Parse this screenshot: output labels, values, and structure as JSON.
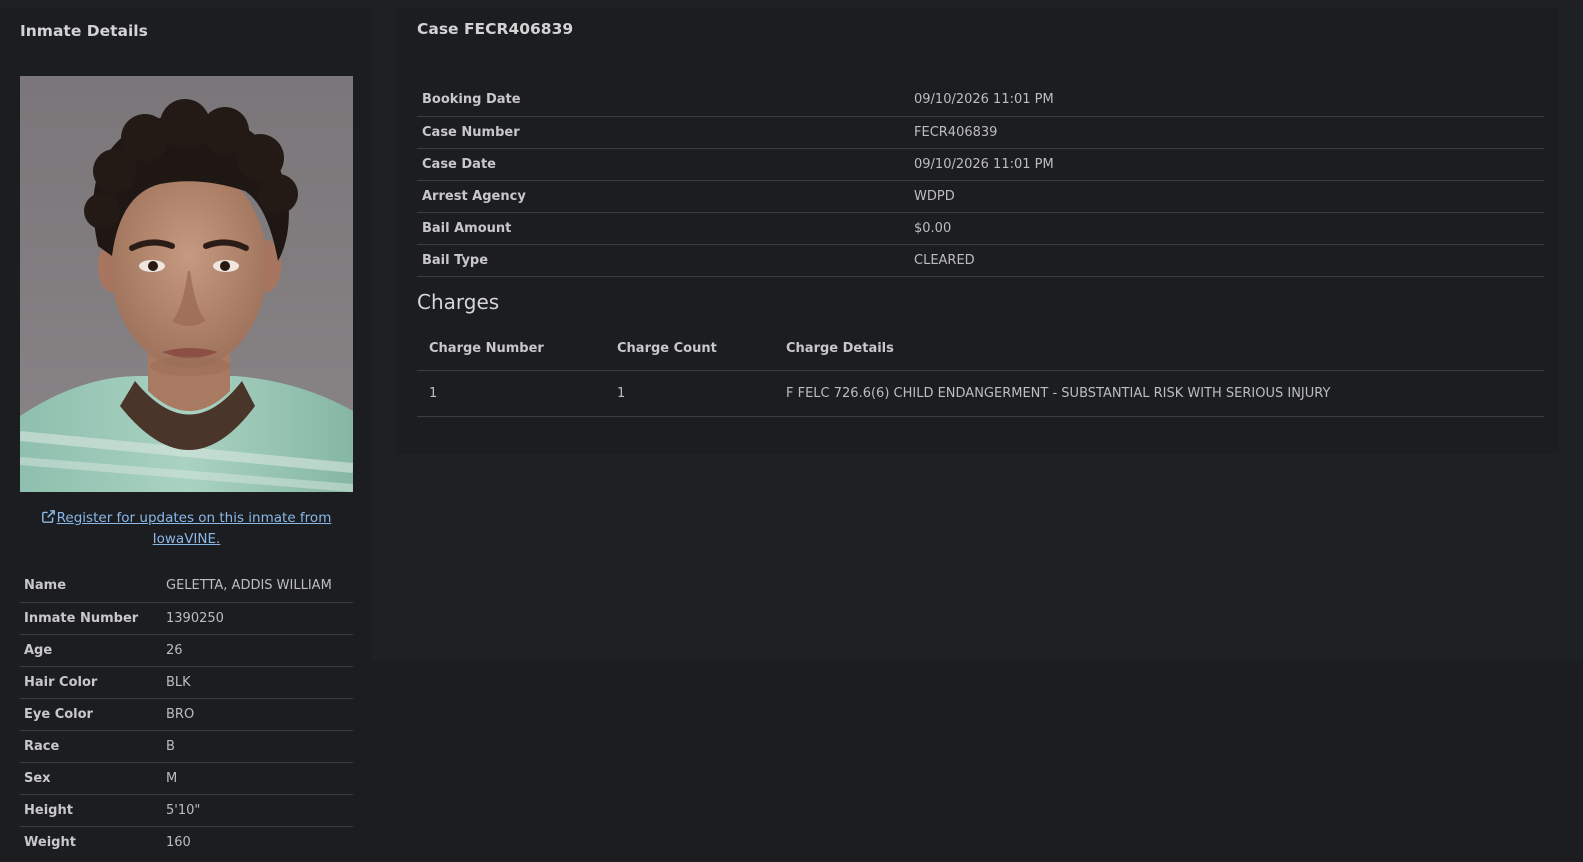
{
  "inmate": {
    "section_title": "Inmate Details",
    "register_link": "Register for updates on this inmate from IowaVINE.",
    "details": [
      {
        "label": "Name",
        "value": "GELETTA, ADDIS WILLIAM"
      },
      {
        "label": "Inmate Number",
        "value": "1390250"
      },
      {
        "label": "Age",
        "value": "26"
      },
      {
        "label": "Hair Color",
        "value": "BLK"
      },
      {
        "label": "Eye Color",
        "value": "BRO"
      },
      {
        "label": "Race",
        "value": "B"
      },
      {
        "label": "Sex",
        "value": "M"
      },
      {
        "label": "Height",
        "value": "5'10\""
      },
      {
        "label": "Weight",
        "value": "160"
      }
    ]
  },
  "case": {
    "title": "Case FECR406839",
    "details": [
      {
        "label": "Booking Date",
        "value": "09/10/2026 11:01 PM"
      },
      {
        "label": "Case Number",
        "value": "FECR406839"
      },
      {
        "label": "Case Date",
        "value": "09/10/2026 11:01 PM"
      },
      {
        "label": "Arrest Agency",
        "value": "WDPD"
      },
      {
        "label": "Bail Amount",
        "value": "$0.00"
      },
      {
        "label": "Bail Type",
        "value": "CLEARED"
      }
    ]
  },
  "charges": {
    "heading": "Charges",
    "columns": [
      "Charge Number",
      "Charge Count",
      "Charge Details"
    ],
    "rows": [
      {
        "number": "1",
        "count": "1",
        "details": "F FELC 726.6(6) CHILD ENDANGERMENT - SUBSTANTIAL RISK WITH SERIOUS INJURY"
      }
    ]
  },
  "colors": {
    "background": "#1b1d20",
    "panel": "#1e2124",
    "link": "#8bb8e8",
    "divider": "#3a3e42"
  },
  "icons": {
    "register_link_icon": "external-link-icon"
  }
}
